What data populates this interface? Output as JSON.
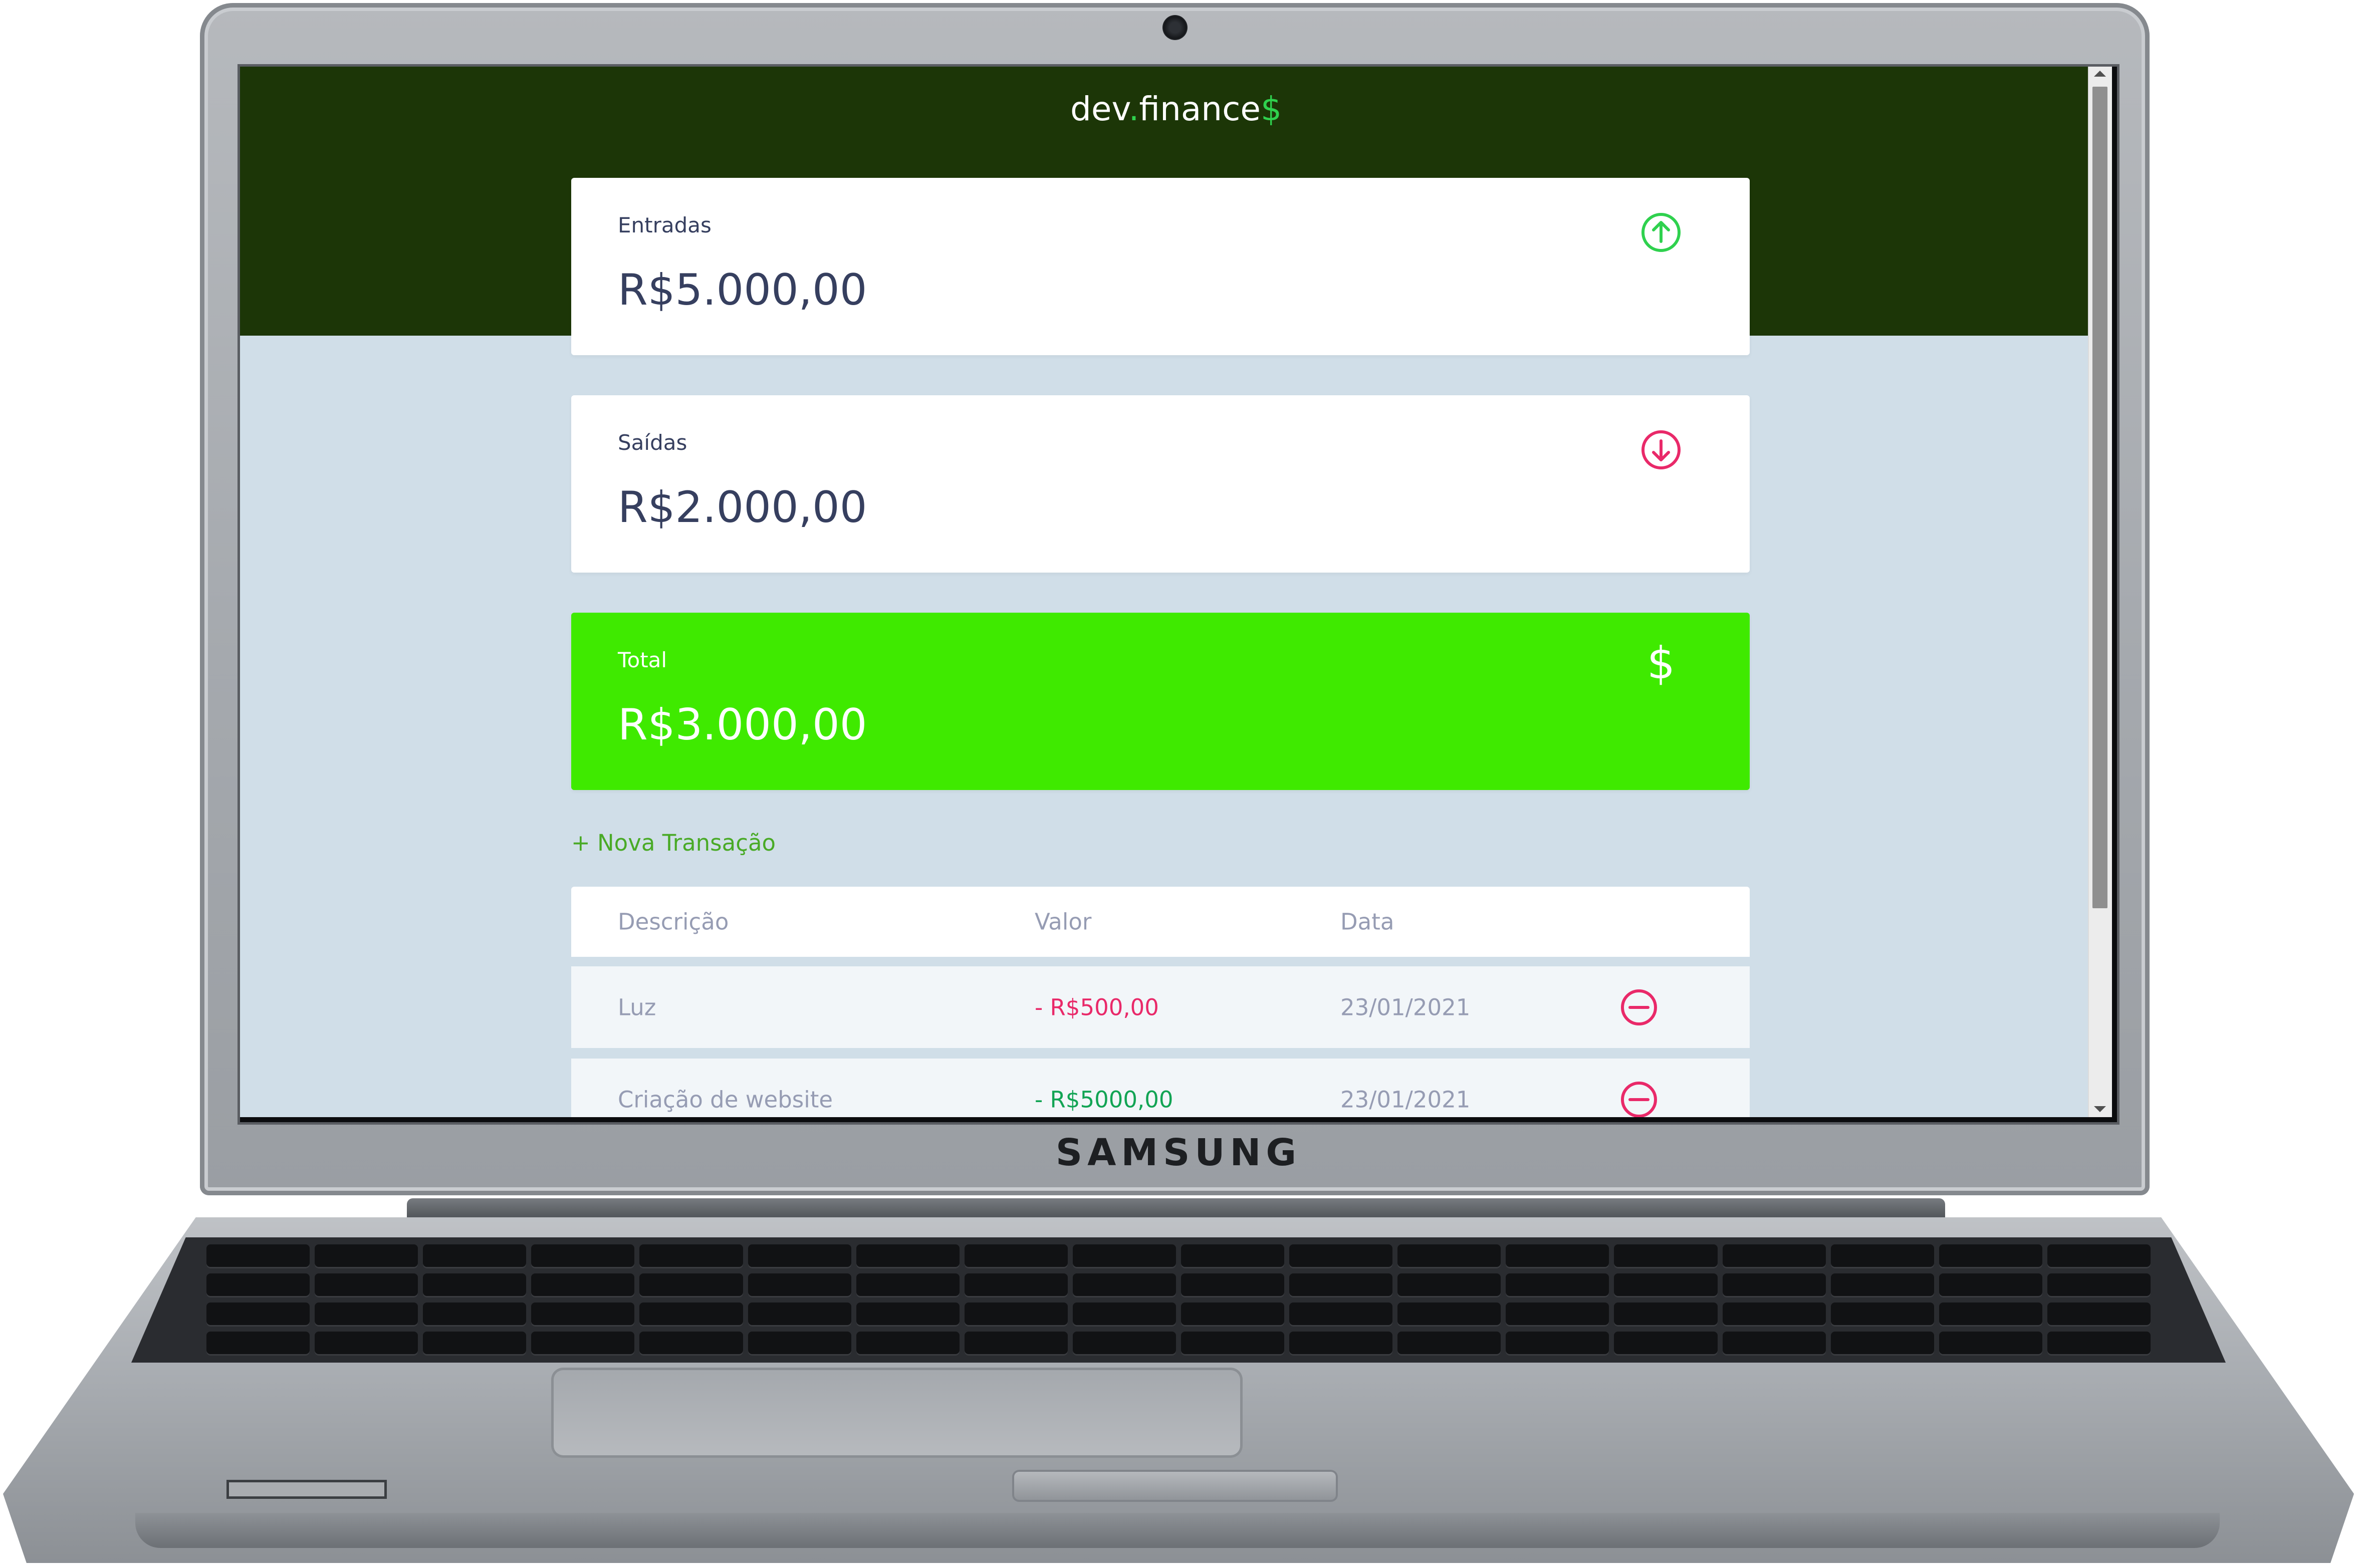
{
  "device": {
    "brand": "SAMSUNG"
  },
  "app": {
    "logo": {
      "text": "dev",
      "dot": ".",
      "text2": "finance",
      "dollar": "$"
    },
    "cards": {
      "income": {
        "label": "Entradas",
        "value": "R$5.000,00",
        "icon": "arrow-up-circle-icon",
        "icon_color": "#2fd14e"
      },
      "expense": {
        "label": "Saídas",
        "value": "R$2.000,00",
        "icon": "arrow-down-circle-icon",
        "icon_color": "#e92969"
      },
      "total": {
        "label": "Total",
        "value": "R$3.000,00",
        "icon": "dollar-icon",
        "icon_text": "$",
        "bg_color": "#3fea00"
      }
    },
    "new_transaction_label": "+ Nova Transação",
    "table": {
      "headers": [
        "Descrição",
        "Valor",
        "Data"
      ],
      "rows": [
        {
          "description": "Luz",
          "value": "- R$500,00",
          "date": "23/01/2021"
        },
        {
          "description": "Criação de website",
          "value": "- R$5000,00",
          "date": "23/01/2021"
        }
      ]
    },
    "colors": {
      "header_bg": "#1c3607",
      "page_bg": "#d0dee8",
      "accent_green": "#49aa26",
      "expense_red": "#e92969",
      "income_green": "#12a454"
    }
  }
}
